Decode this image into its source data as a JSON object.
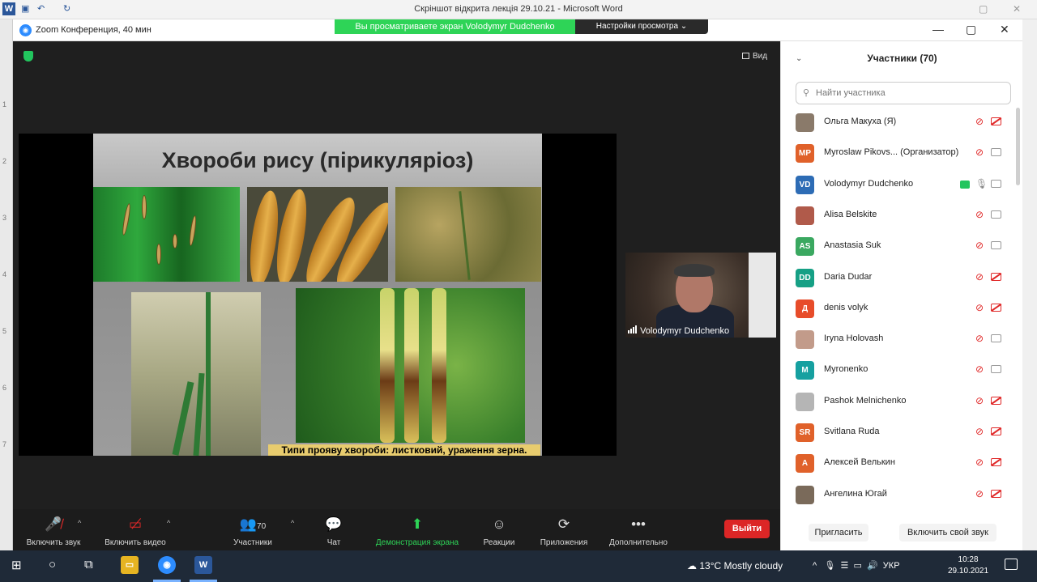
{
  "word": {
    "title": "Скріншот відкрита лекція 29.10.21  -  Microsoft Word",
    "app_icon": "W",
    "ruler_numbers": [
      "1",
      "2",
      "3",
      "4",
      "5",
      "6",
      "7"
    ]
  },
  "zoom": {
    "window_title": "Zoom Конференция, 40 мин",
    "share_banner": "Вы просматриваете экран Volodymyr Dudchenko",
    "view_options": "Настройки просмотра ⌄",
    "view_label": "Вид"
  },
  "slide": {
    "title": "Хвороби рису (пірикуляріоз)",
    "caption": "Типи прояву хвороби:  листковий, ураження зерна."
  },
  "camera": {
    "name": "Volodymyr Dudchenko"
  },
  "toolbar": {
    "unmute": "Включить звук",
    "start_video": "Включить видео",
    "participants": "Участники",
    "participants_count": "70",
    "chat": "Чат",
    "share_screen": "Демонстрация экрана",
    "reactions": "Реакции",
    "apps": "Приложения",
    "more": "Дополнительно",
    "leave": "Выйти"
  },
  "panel": {
    "title": "Участники (70)",
    "search_placeholder": "Найти участника",
    "invite": "Пригласить",
    "unmute_self": "Включить свой звук",
    "participants": [
      {
        "initials": "",
        "name": "Ольга Макуха (Я)",
        "color": "#8a7a6a",
        "mic": "muted",
        "video": "off"
      },
      {
        "initials": "MP",
        "name": "Myroslaw Pikovs... (Организатор)",
        "color": "#e0612a",
        "mic": "muted",
        "video": "gray"
      },
      {
        "initials": "VD",
        "name": "Volodymyr Dudchenko",
        "color": "#2d6cb5",
        "mic": "gray",
        "video": "gray",
        "sharing": true
      },
      {
        "initials": "",
        "name": "Alisa Belskite",
        "color": "#b05a4a",
        "mic": "muted",
        "video": "gray"
      },
      {
        "initials": "AS",
        "name": "Anastasia Suk",
        "color": "#3aa860",
        "mic": "muted",
        "video": "gray"
      },
      {
        "initials": "DD",
        "name": "Daria Dudar",
        "color": "#16a085",
        "mic": "muted",
        "video": "off"
      },
      {
        "initials": "Д",
        "name": "denis volyk",
        "color": "#e74c2a",
        "mic": "muted",
        "video": "off"
      },
      {
        "initials": "",
        "name": "Iryna Holovash",
        "color": "#c29b8a",
        "mic": "muted",
        "video": "gray"
      },
      {
        "initials": "M",
        "name": "Myronenko",
        "color": "#16a0a0",
        "mic": "muted",
        "video": "gray"
      },
      {
        "initials": "",
        "name": "Pashok Melnichenko",
        "color": "#b5b5b5",
        "mic": "muted",
        "video": "off"
      },
      {
        "initials": "SR",
        "name": "Svitlana Ruda",
        "color": "#e0612a",
        "mic": "muted",
        "video": "off"
      },
      {
        "initials": "A",
        "name": "Алексей Велькин",
        "color": "#e0612a",
        "mic": "muted",
        "video": "off"
      },
      {
        "initials": "",
        "name": "Ангелина Югай",
        "color": "#7a6a5a",
        "mic": "muted",
        "video": "off"
      }
    ]
  },
  "taskbar": {
    "weather": "13°C  Mostly cloudy",
    "language": "УКР",
    "time": "10:28",
    "date": "29.10.2021"
  }
}
